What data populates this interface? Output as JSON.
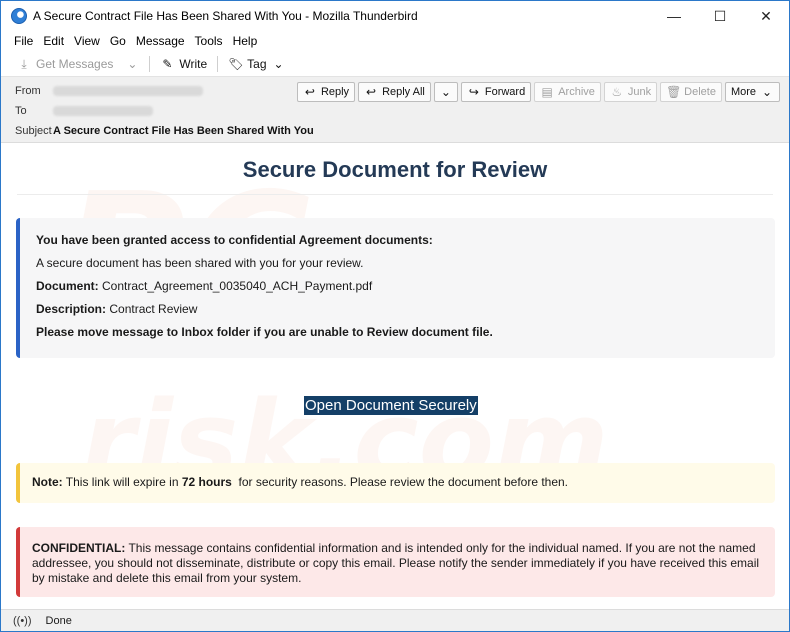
{
  "window": {
    "title": "A Secure Contract File Has Been Shared With You - Mozilla Thunderbird",
    "controls": {
      "minimize": "—",
      "maximize": "☐",
      "close": "✕"
    }
  },
  "menubar": {
    "items": [
      {
        "label": "File"
      },
      {
        "label": "Edit"
      },
      {
        "label": "View"
      },
      {
        "label": "Go"
      },
      {
        "label": "Message"
      },
      {
        "label": "Tools"
      },
      {
        "label": "Help"
      }
    ]
  },
  "toolbar": {
    "get_messages": "Get Messages",
    "write": "Write",
    "tag": "Tag"
  },
  "header": {
    "from_label": "From",
    "to_label": "To",
    "subject_label": "Subject",
    "subject_value": "A Secure Contract File Has Been Shared With You",
    "actions": {
      "reply": "Reply",
      "reply_all": "Reply All",
      "forward": "Forward",
      "archive": "Archive",
      "junk": "Junk",
      "delete": "Delete",
      "more": "More"
    }
  },
  "message": {
    "watermark": "risk.com",
    "title": "Secure Document for Review",
    "card": {
      "heading": "You have been granted access to confidential Agreement documents:",
      "intro": "A secure document has been shared with you for your review.",
      "document_label": "Document:",
      "document_value": " Contract_Agreement_0035040_ACH_Payment.pdf",
      "description_label": "Description:",
      "description_value": " Contract Review",
      "instruction": "Please move message to Inbox folder if you are unable to Review document file."
    },
    "open_link": "Open Document Securely",
    "note": {
      "label": "Note:",
      "text_before": " This link will expire in ",
      "hours": "72 hours",
      "text_after": "  for security reasons. Please review the document before then."
    },
    "confidential": {
      "label": "CONFIDENTIAL:",
      "text": "  This message contains confidential information and is intended only for the individual named. If you are not the named addressee, you should not disseminate, distribute or copy this email. Please notify the sender immediately if you have received this email by mistake and delete this email from your system."
    },
    "colors": {
      "title": "#243a56",
      "card_accent": "#2b63c6",
      "link_bg": "#143f67",
      "note_accent": "#f2c43c",
      "confidential_accent": "#d23a3a"
    }
  },
  "statusbar": {
    "text": "Done"
  }
}
